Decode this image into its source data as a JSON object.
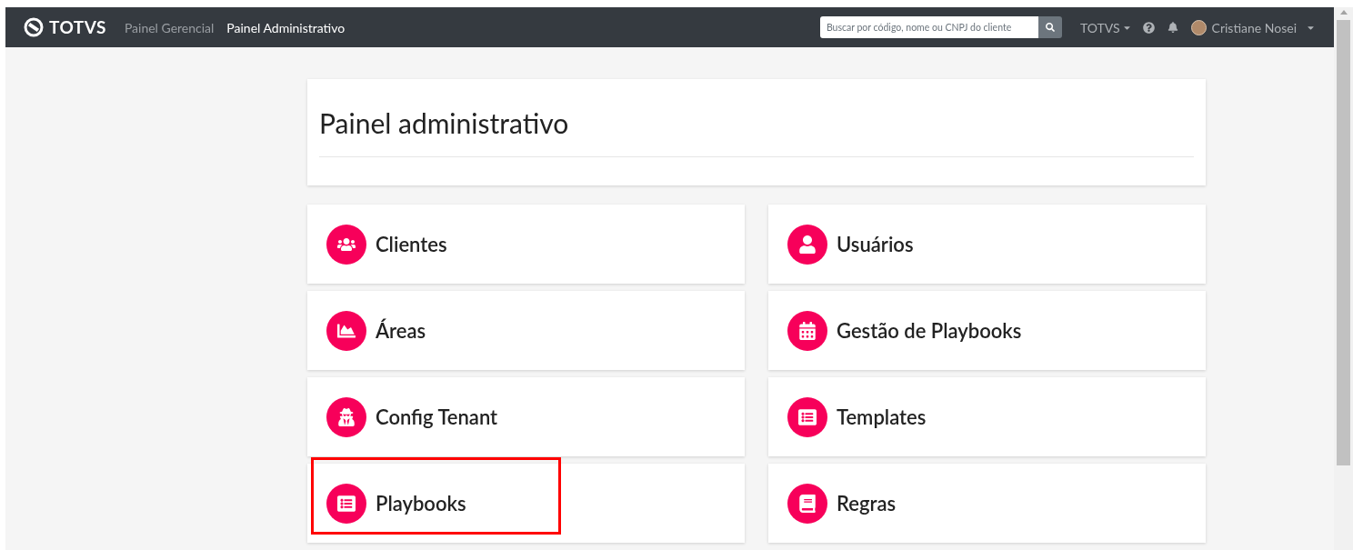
{
  "navbar": {
    "brand": "TOTVS",
    "links": [
      {
        "label": "Painel Gerencial",
        "selected": false
      },
      {
        "label": "Painel Administrativo",
        "selected": true
      }
    ],
    "search": {
      "placeholder": "Buscar por código, nome ou CNPJ do cliente"
    },
    "org_menu": "TOTVS",
    "user_name": "Cristiane Nosei"
  },
  "page_title": "Painel administrativo",
  "cards": [
    {
      "label": "Clientes",
      "kind": "users",
      "highlighted": false
    },
    {
      "label": "Usuários",
      "kind": "user",
      "highlighted": false
    },
    {
      "label": "Áreas",
      "kind": "area",
      "highlighted": false
    },
    {
      "label": "Gestão de Playbooks",
      "kind": "calendar",
      "highlighted": false
    },
    {
      "label": "Config Tenant",
      "kind": "secret",
      "highlighted": false
    },
    {
      "label": "Templates",
      "kind": "list",
      "highlighted": false
    },
    {
      "label": "Playbooks",
      "kind": "list",
      "highlighted": true
    },
    {
      "label": "Regras",
      "kind": "book",
      "highlighted": false
    }
  ]
}
